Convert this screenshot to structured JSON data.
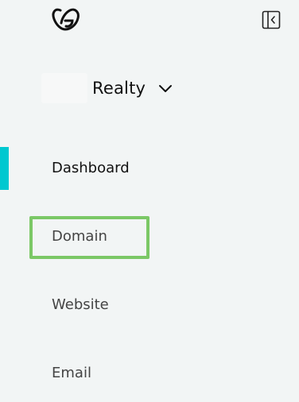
{
  "sidebar": {
    "logo_icon": "godaddy-logo-icon",
    "collapse_icon": "collapse-sidebar-icon",
    "account": {
      "name": "Realty",
      "chevron_icon": "chevron-down-icon"
    },
    "nav": {
      "items": [
        {
          "label": "Dashboard",
          "active": true
        },
        {
          "label": "Domain",
          "active": false,
          "highlighted": true
        },
        {
          "label": "Website",
          "active": false
        },
        {
          "label": "Email",
          "active": false
        }
      ]
    },
    "colors": {
      "background": "#f2f5f5",
      "active_indicator": "#00c8d0",
      "highlight_border": "#7bc866",
      "text_primary": "#111111",
      "text_secondary": "#444444"
    }
  }
}
